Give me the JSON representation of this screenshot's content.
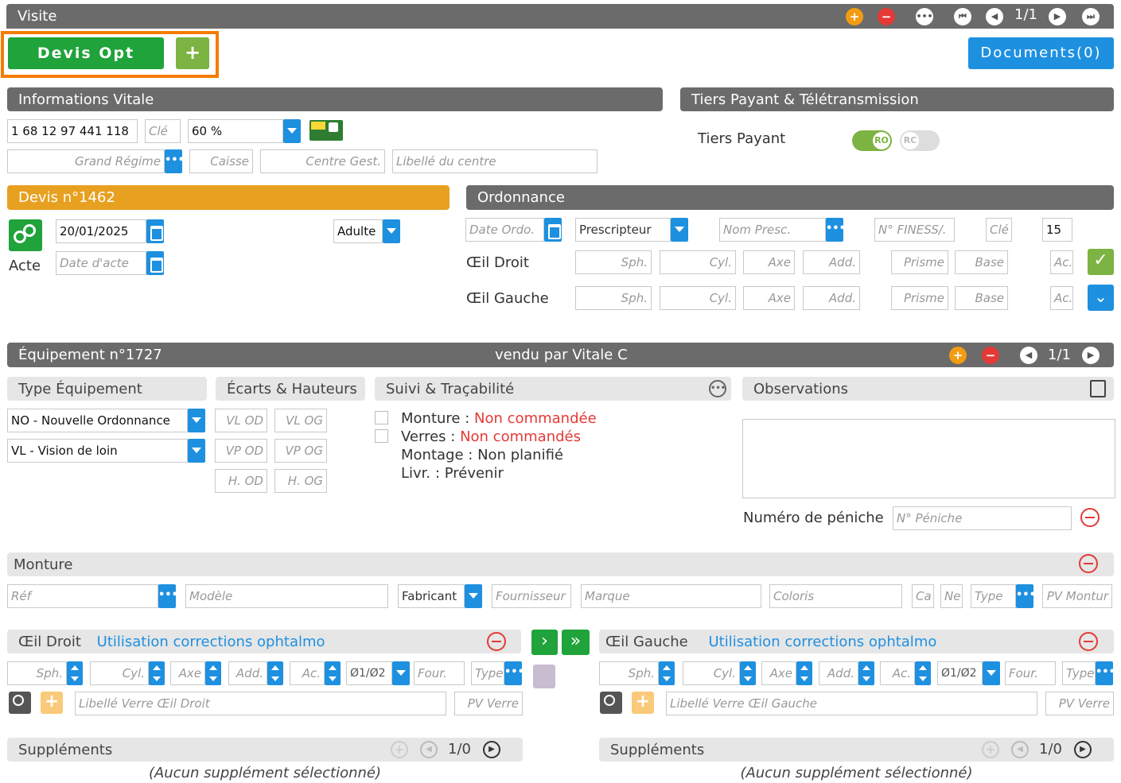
{
  "visite": {
    "title": "Visite",
    "pager": "1/1"
  },
  "devis_opt": {
    "label": "Devis Opt",
    "add_label": "+"
  },
  "documents": {
    "label": "Documents(0)"
  },
  "vitale": {
    "title": "Informations Vitale",
    "nir": "1 68 12 97 441 118",
    "cle_placeholder": "Clé",
    "taux": "60 %",
    "grand_regime_placeholder": "Grand Régime",
    "caisse_placeholder": "Caisse",
    "centre_gest_placeholder": "Centre Gest.",
    "libelle_centre_placeholder": "Libellé du centre"
  },
  "tiers": {
    "title": "Tiers Payant & Télétransmission",
    "label": "Tiers Payant",
    "ro": "RO",
    "rc": "RC"
  },
  "devis": {
    "title": "Devis n°1462",
    "date": "20/01/2025",
    "acte_label": "Acte",
    "date_acte_placeholder": "Date d'acte",
    "type": "Adulte"
  },
  "ordonnance": {
    "title": "Ordonnance",
    "date_placeholder": "Date Ordo.",
    "prescripteur": "Prescripteur",
    "nom_presc_placeholder": "Nom Presc.",
    "finess_placeholder": "N° FINESS/.",
    "cle_placeholder": "Clé",
    "duree": "15",
    "oeil_droit": "Œil Droit",
    "oeil_gauche": "Œil Gauche",
    "sph": "Sph.",
    "cyl": "Cyl.",
    "axe": "Axe",
    "add": "Add.",
    "prisme": "Prisme",
    "base": "Base",
    "ac": "Ac."
  },
  "equipement": {
    "title": "Équipement n°1727",
    "vendu": "vendu par Vitale C",
    "pager": "1/1",
    "type_title": "Type Équipement",
    "type1": "NO - Nouvelle Ordonnance",
    "type2": "VL - Vision de loin",
    "ecarts_title": "Écarts & Hauteurs",
    "vl_od": "VL OD",
    "vl_og": "VL OG",
    "vp_od": "VP OD",
    "vp_og": "VP OG",
    "h_od": "H. OD",
    "h_og": "H. OG",
    "suivi_title": "Suivi & Traçabilité",
    "monture_label": "Monture",
    "monture_status": "Non commandée",
    "verres_label": "Verres",
    "verres_status": "Non commandés",
    "montage_label": "Montage",
    "montage_status": "Non planifié",
    "livr_label": "Livr.",
    "livr_status": "Prévenir",
    "sep": ":",
    "obs_title": "Observations",
    "peniche_label": "Numéro de péniche",
    "peniche_placeholder": "N° Péniche"
  },
  "monture": {
    "title": "Monture",
    "ref": "Réf",
    "modele": "Modèle",
    "fabricant": "Fabricant",
    "fournisseur": "Fournisseur",
    "marque": "Marque",
    "coloris": "Coloris",
    "ca": "Ca",
    "ne": "Ne",
    "type": "Type",
    "pv": "PV Montur"
  },
  "verres": {
    "od_title": "Œil Droit",
    "og_title": "Œil Gauche",
    "link": "Utilisation corrections ophtalmo",
    "sph": "Sph.",
    "cyl": "Cyl.",
    "axe": "Axe",
    "add": "Add.",
    "ac": "Ac.",
    "diam": "Ø1/Ø2",
    "four": "Four.",
    "type": "Type",
    "libelle_od": "Libellé Verre Œil Droit",
    "libelle_og": "Libellé Verre Œil Gauche",
    "pv": "PV Verre"
  },
  "supplements": {
    "title": "Suppléments",
    "pager": "1/0",
    "empty": "(Aucun supplément sélectionné)"
  },
  "colors": {
    "accent": "#1e90e0",
    "green": "#1fa33a",
    "orange": "#e8a020",
    "red": "#e53935",
    "header": "#6b6b6b"
  }
}
